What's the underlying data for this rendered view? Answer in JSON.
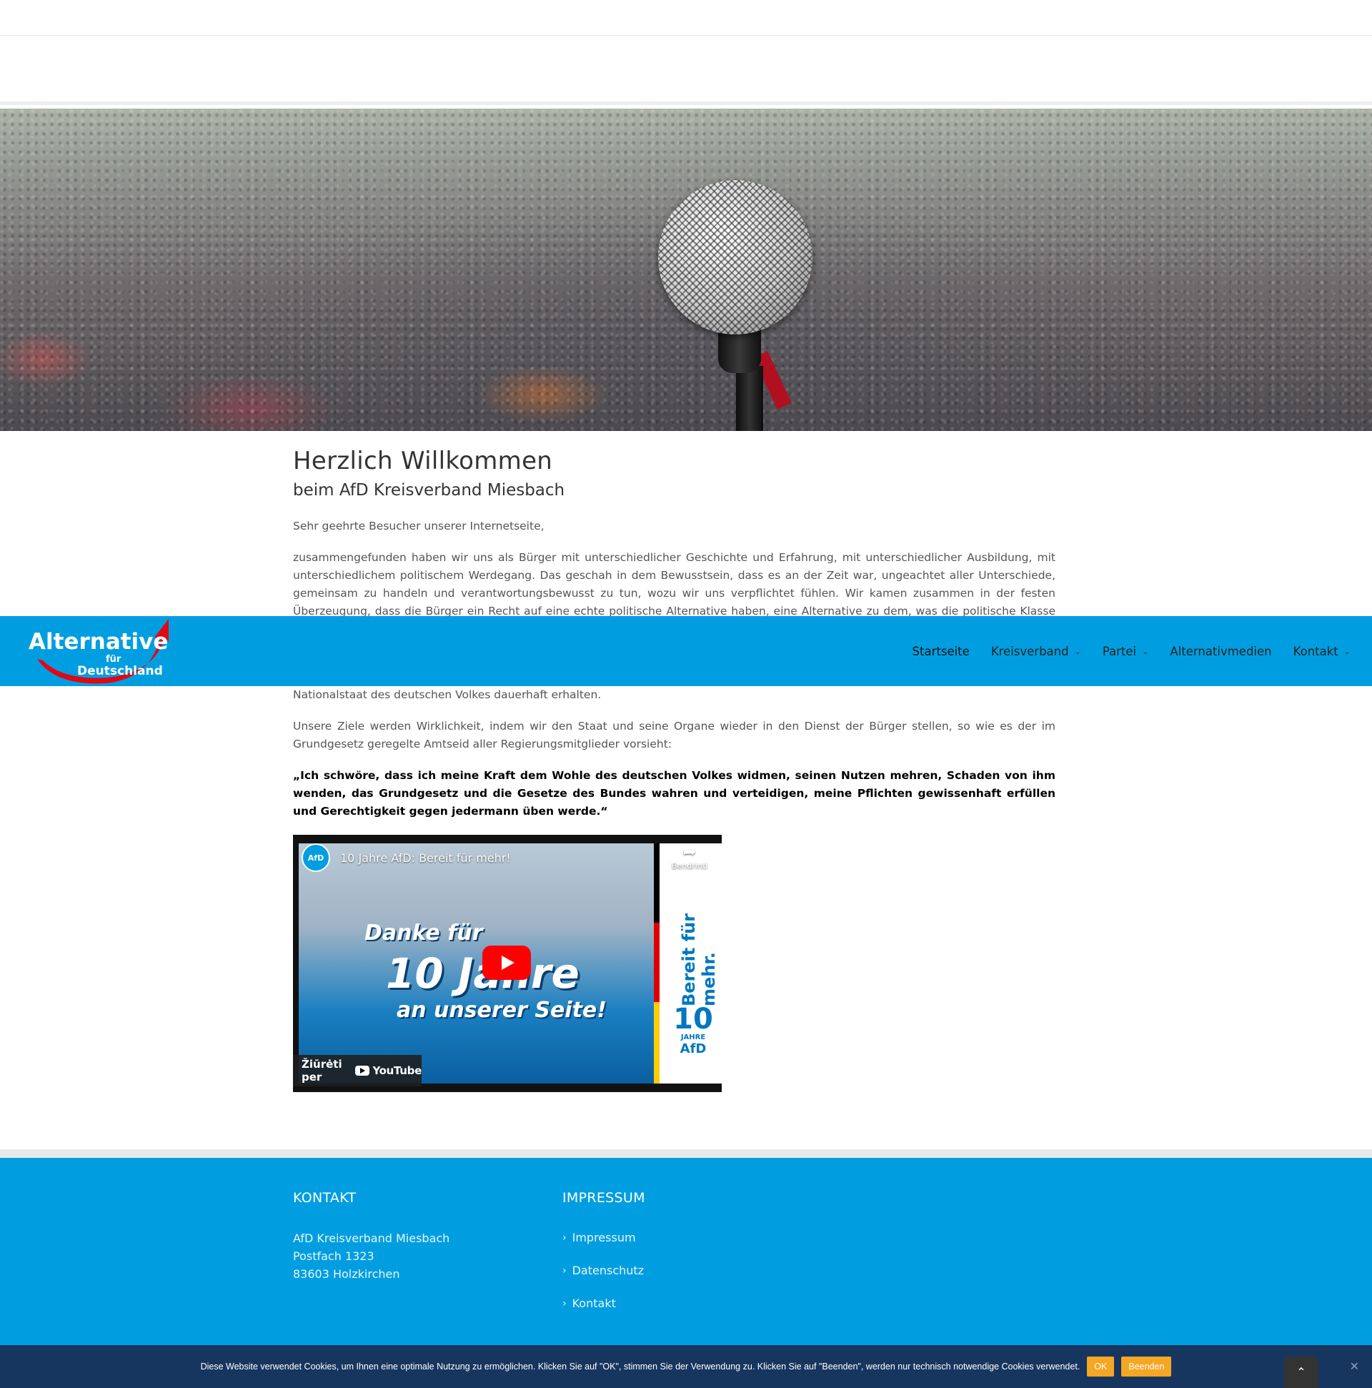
{
  "colors": {
    "brand_blue": "#009ee0",
    "cookie_bg": "#17365f",
    "accent_orange": "#f5a623",
    "logo_red": "#e30613"
  },
  "logo": {
    "alt_word": "Alternative",
    "fuer": "für",
    "deutschland": "Deutschland"
  },
  "nav": {
    "items": [
      {
        "label": "Startseite",
        "active": true
      },
      {
        "label": "Kreisverband",
        "has_dropdown": true
      },
      {
        "label": "Partei",
        "has_dropdown": true
      },
      {
        "label": "Alternativmedien"
      },
      {
        "label": "Kontakt",
        "has_dropdown": true
      }
    ]
  },
  "main": {
    "title": "Herzlich Willkommen",
    "subtitle": "beim AfD Kreisverband Miesbach",
    "greeting": "Sehr geehrte Besucher unserer Internetseite,",
    "paragraph1": "zusammengefunden haben wir uns als Bürger mit unterschiedlicher Geschichte und Erfahrung, mit unterschiedlicher Ausbildung, mit unterschiedlichem politischem Werdegang. Das geschah in dem Bewusstsein, dass es an der Zeit war, ungeachtet aller Unterschiede, gemeinsam zu handeln und verantwortungsbewusst zu tun, wozu wir uns verpflichtet fühlen. Wir kamen zusammen in der festen Überzeugung, dass die Bürger ein Recht auf eine echte politische Alternative haben, eine Alternative zu dem, was die politische Klasse glaubt, uns als „alternativlos“ zumuten zu können.",
    "paragraph2_tail": "Nationalstaat des deutschen Volkes dauerhaft erhalten.",
    "paragraph3": "Unsere Ziele werden Wirklichkeit, indem wir den Staat und seine Organe wieder in den Dienst der Bürger stellen, so wie es der im Grundgesetz geregelte Amtseid aller Regierungsmitglieder vorsieht:",
    "oath": "„Ich schwöre, dass ich meine Kraft dem Wohle des deutschen Volkes widmen, seinen Nutzen mehren, Schaden von ihm wenden, das Grundgesetz und die Gesetze des Bundes wahren und verteidigen, meine Pflichten gewissenhaft erfüllen und Gerechtigkeit gegen jedermann üben werde.“"
  },
  "video": {
    "channel": "AfD",
    "title": "10 Jahre AfD: Bereit für mehr!",
    "share_label": "Bendrinti",
    "line1": "Danke für",
    "line2": "10 Jahre",
    "line3": "an unserer Seite!",
    "side_text": "Bereit für mehr.",
    "ten_number": "10",
    "ten_jahre": "JAHRE",
    "ten_afd": "AfD",
    "watch_on": "Žiūrėti per",
    "youtube": "YouTube"
  },
  "footer": {
    "kontakt_heading": "KONTAKT",
    "address": [
      "AfD Kreisverband Miesbach",
      "Postfach 1323",
      "83603 Holzkirchen"
    ],
    "impressum_heading": "IMPRESSUM",
    "links": [
      "Impressum",
      "Datenschutz",
      "Kontakt"
    ]
  },
  "cookie": {
    "message": "Diese Website verwendet Cookies, um Ihnen eine optimale Nutzung zu ermöglichen. Klicken Sie auf \"OK\", stimmen Sie der Verwendung zu. Klicken Sie auf \"Beenden\", werden nur technisch notwendige Cookies verwendet.",
    "ok_label": "OK",
    "end_label": "Beenden",
    "close_label": "✕"
  },
  "to_top_icon": "chevron-up-icon"
}
